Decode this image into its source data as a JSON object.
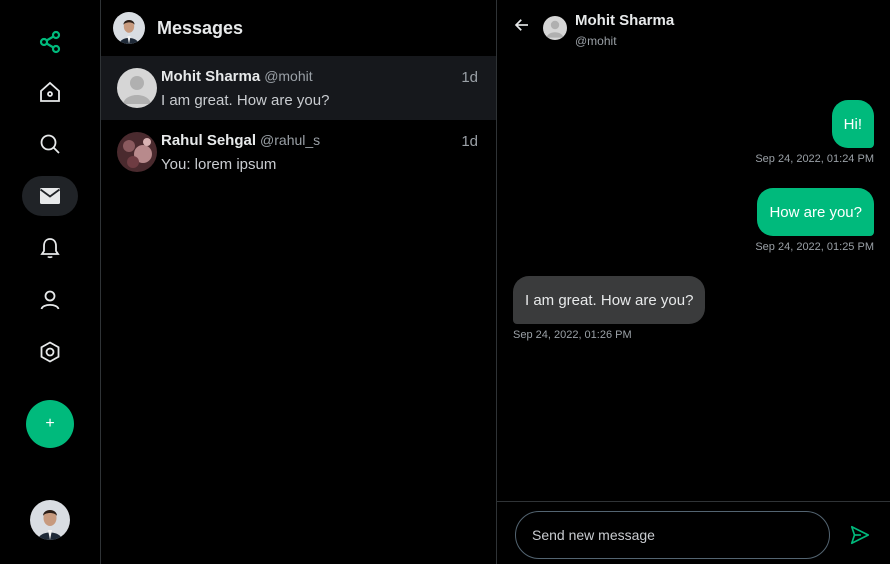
{
  "theme": {
    "accent": "#00ba7c",
    "bubble_in": "#3a3b3c",
    "selected_row": "#16181c",
    "bg": "#000000"
  },
  "nav": {
    "items": [
      {
        "icon": "share-nodes-icon"
      },
      {
        "icon": "home-icon"
      },
      {
        "icon": "search-icon"
      },
      {
        "icon": "mail-icon",
        "active": true
      },
      {
        "icon": "bell-icon"
      },
      {
        "icon": "user-icon"
      },
      {
        "icon": "settings-hexagon-icon"
      }
    ],
    "compose_label": "+"
  },
  "messages": {
    "title": "Messages",
    "conversations": [
      {
        "name": "Mohit Sharma",
        "handle": "@mohit",
        "time": "1d",
        "preview": "I am great. How are you?",
        "selected": true
      },
      {
        "name": "Rahul Sehgal",
        "handle": "@rahul_s",
        "time": "1d",
        "preview": "You: lorem ipsum",
        "selected": false
      }
    ]
  },
  "chat": {
    "name": "Mohit Sharma",
    "handle": "@mohit",
    "messages": [
      {
        "text": "Hi!",
        "direction": "out",
        "timestamp": "Sep 24, 2022, 01:24 PM"
      },
      {
        "text": "How are you?",
        "direction": "out",
        "timestamp": "Sep 24, 2022, 01:25 PM"
      },
      {
        "text": "I am great. How are you?",
        "direction": "in",
        "timestamp": "Sep 24, 2022, 01:26 PM"
      }
    ],
    "composer": {
      "placeholder": "Send new message"
    }
  }
}
